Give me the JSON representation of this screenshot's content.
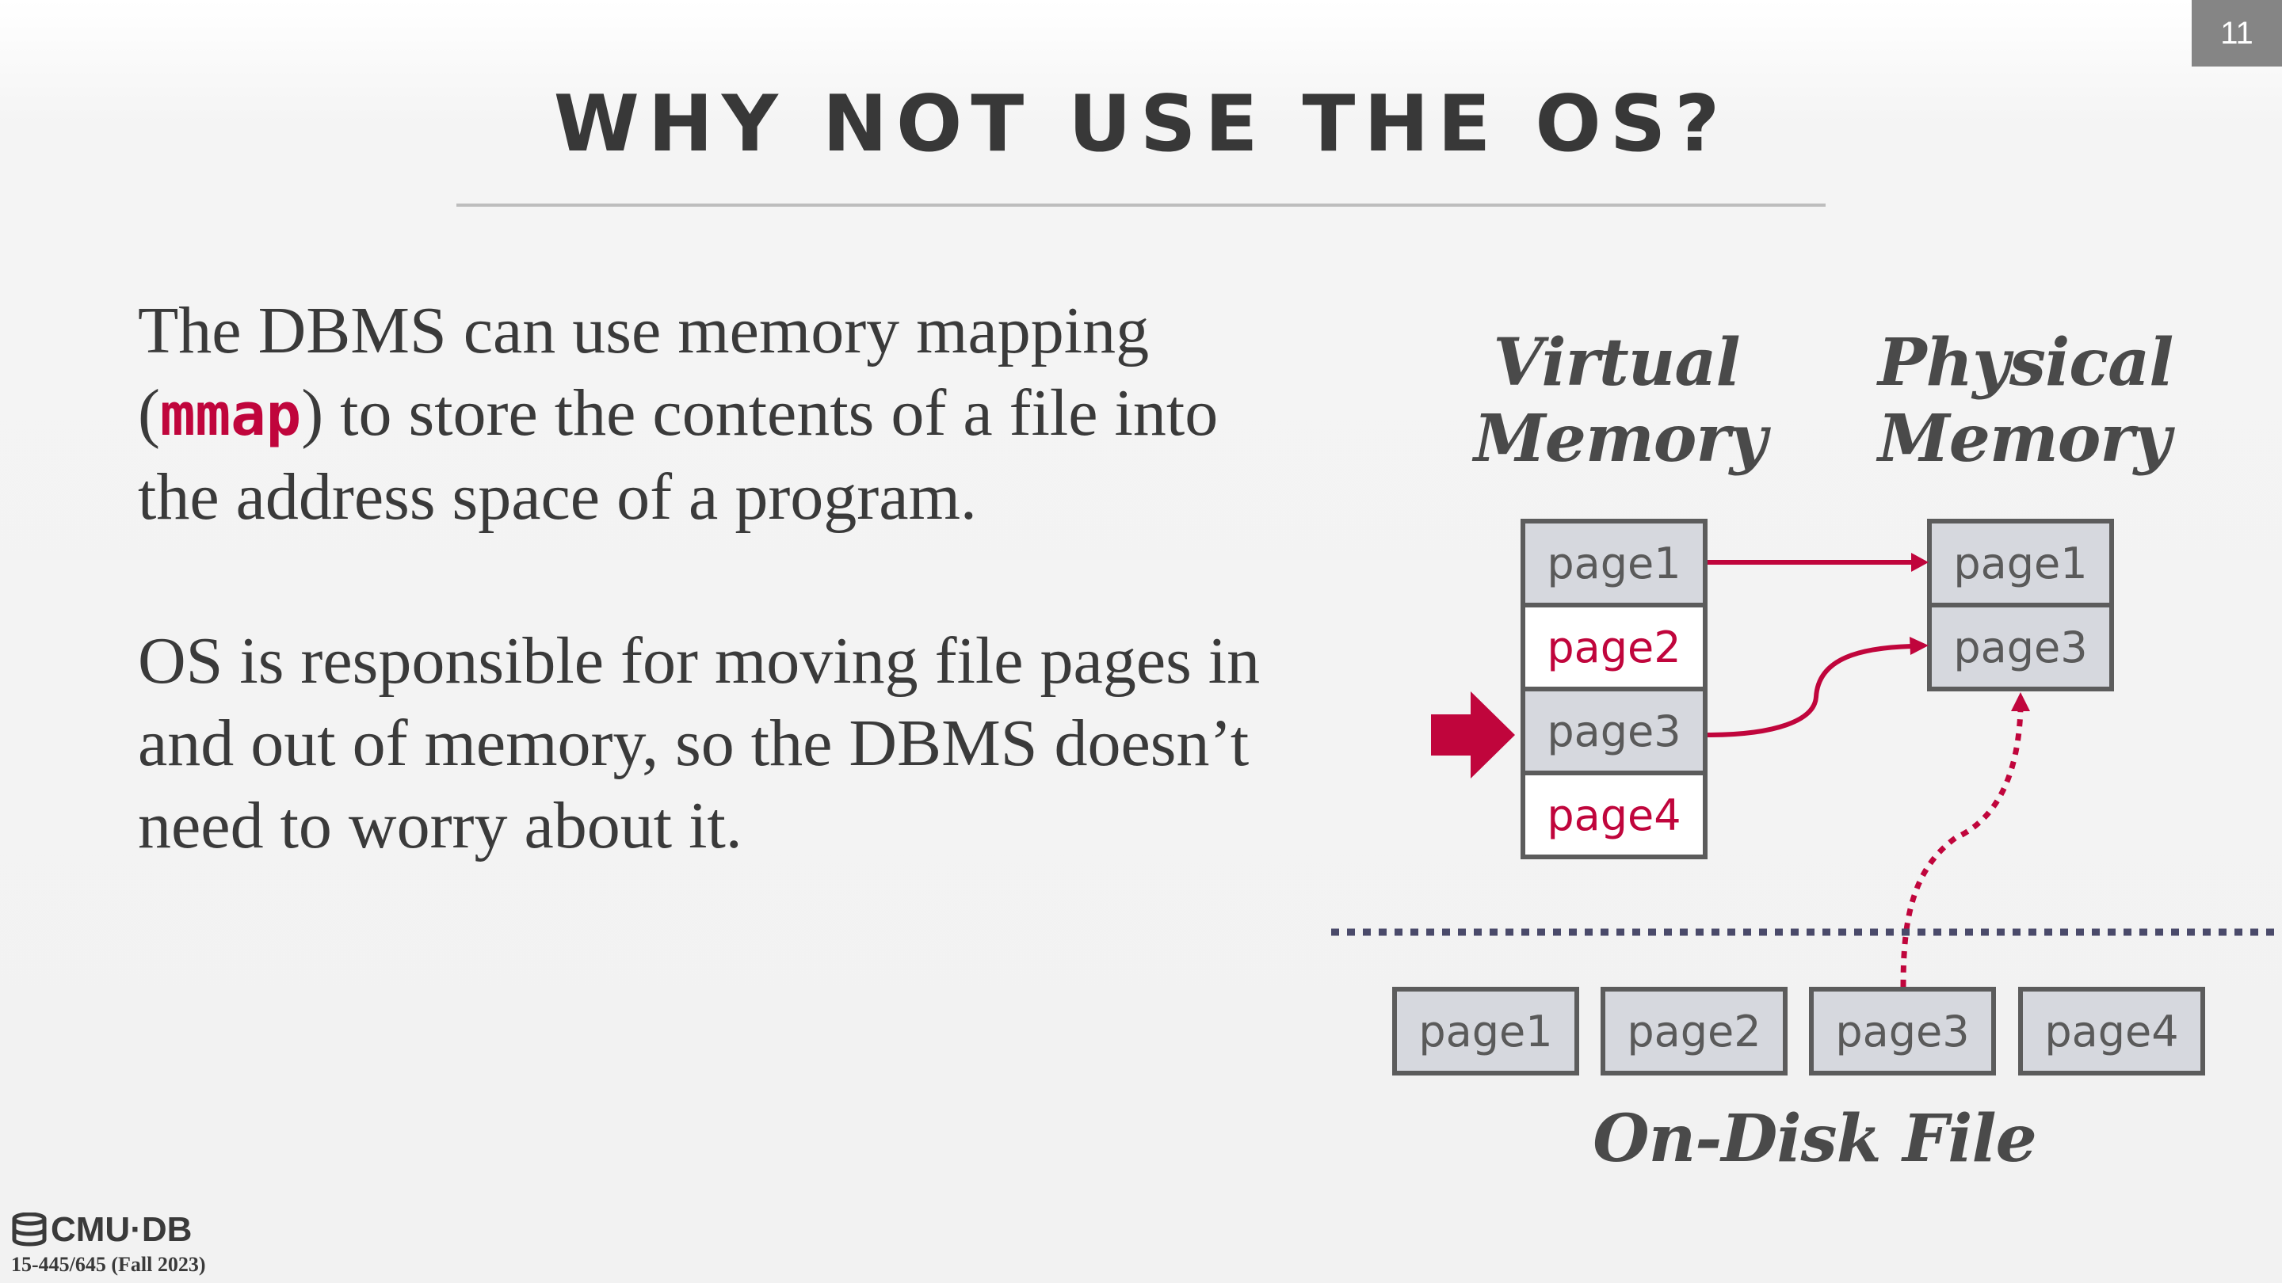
{
  "slide_number": "11",
  "title": "WHY NOT USE THE OS?",
  "paragraph1": {
    "before": "The DBMS can use memory mapping (",
    "code": "mmap",
    "after": ") to store the contents of a file into the address space of a program."
  },
  "paragraph2": "OS is responsible for moving file pages in and out of memory, so the DBMS doesn’t need to worry about it.",
  "diagram": {
    "virtual_label": [
      "Virtual",
      "Memory"
    ],
    "physical_label": [
      "Physical",
      "Memory"
    ],
    "disk_label": "On-Disk File",
    "virtual_pages": [
      "page1",
      "page2",
      "page3",
      "page4"
    ],
    "physical_pages": [
      "page1",
      "page3"
    ],
    "disk_pages": [
      "page1",
      "page2",
      "page3",
      "page4"
    ]
  },
  "footer": {
    "logo": "CMU·DB",
    "course": "15-445/645 (Fall 2023)"
  },
  "colors": {
    "accent": "#c0053c",
    "box_fill": "#d6d8de",
    "box_border": "#5c5c5c",
    "divider": "#4a4a6a"
  }
}
